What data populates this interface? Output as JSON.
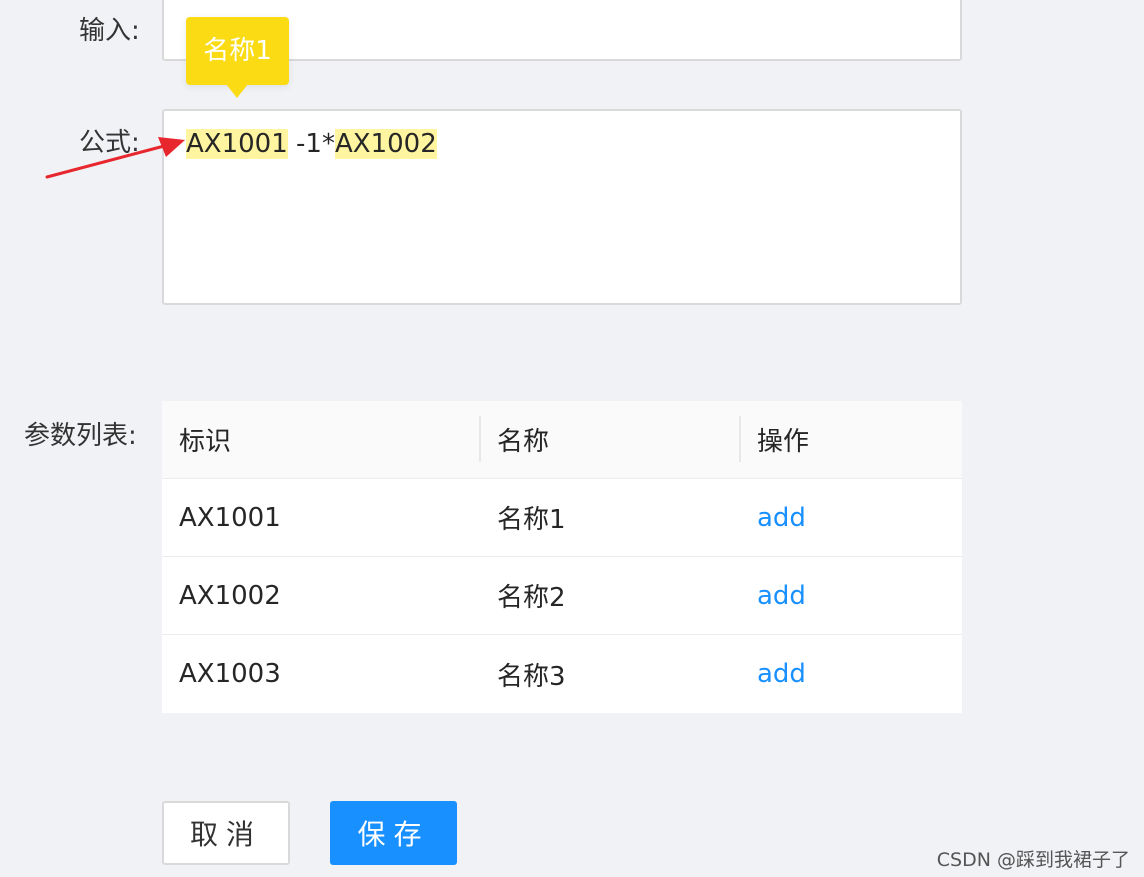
{
  "form": {
    "input_label": "输入:",
    "formula_label": "公式:",
    "params_label": "参数列表:"
  },
  "formula": {
    "token1": "AX1001",
    "operator_text": " -1*",
    "token2": "AX1002",
    "tooltip": "名称1"
  },
  "table": {
    "headers": {
      "id": "标识",
      "name": "名称",
      "action": "操作"
    },
    "rows": [
      {
        "id": "AX1001",
        "name": "名称1",
        "action": "add"
      },
      {
        "id": "AX1002",
        "name": "名称2",
        "action": "add"
      },
      {
        "id": "AX1003",
        "name": "名称3",
        "action": "add"
      }
    ]
  },
  "buttons": {
    "cancel": "取消",
    "save": "保存"
  },
  "colors": {
    "primary": "#1890ff",
    "tooltip": "#fadb14",
    "token_highlight": "#fff5a0",
    "annotation_arrow": "#e8262d"
  },
  "watermark": "CSDN @踩到我裙子了"
}
